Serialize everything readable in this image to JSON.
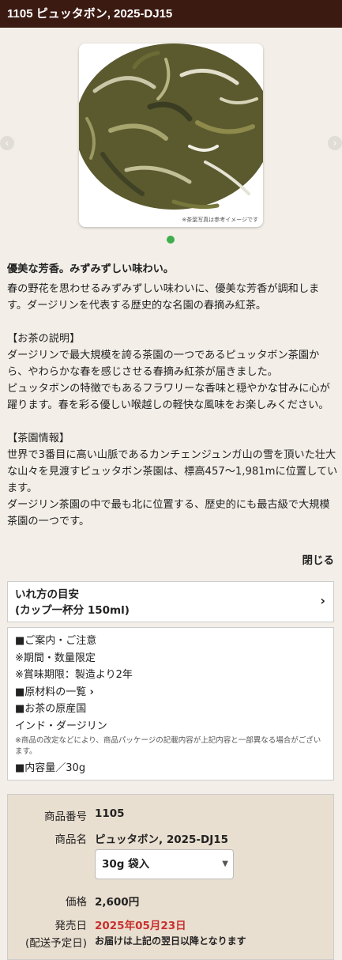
{
  "header": {
    "title": "1105 ピュッタボン, 2025-DJ15"
  },
  "gallery": {
    "caption": "※茶葉写真は参考イメージです",
    "prev_icon": "chevron-left-icon",
    "next_icon": "chevron-right-icon",
    "prev_glyph": "‹",
    "next_glyph": "›",
    "dot_color": "#3fae4c"
  },
  "description": {
    "catch": "優美な芳香。みずみずしい味わい。",
    "p1": "春の野花を思わせるみずみずしい味わいに、優美な芳香が調和します。ダージリンを代表する歴史的な名園の春摘み紅茶。",
    "p2_title": "【お茶の説明】",
    "p2": "ダージリンで最大規模を誇る茶園の一つであるピュッタボン茶園から、やわらかな春を感じさせる春摘み紅茶が届きました。\nピュッタボンの特徴でもあるフラワリーな香味と穏やかな甘みに心が躍ります。春を彩る優しい喉越しの軽快な風味をお楽しみください。",
    "p3_title": "【茶園情報】",
    "p3": "世界で3番目に高い山脈であるカンチェンジュンガ山の雪を頂いた壮大な山々を見渡すピュッタボン茶園は、標高457～1,981mに位置しています。\nダージリン茶園の中で最も北に位置する、歴史的にも最古級で大規模茶園の一つです。",
    "close": "閉じる"
  },
  "brew_guide": {
    "line1": "いれ方の目安",
    "line2": "(カップ一杯分 150ml)",
    "chevron": "›"
  },
  "notes": {
    "l1": "■ご案内・ご注意",
    "l2": "※期間・数量限定",
    "l3": "※賞味期限：製造より2年",
    "l4": "■原材料の一覧",
    "l4_chev": "›",
    "l5": "■お茶の原産国",
    "l6": "インド・ダージリン",
    "small": "※商品の改定などにより、商品パッケージの記載内容が上記内容と一部異なる場合がございます。",
    "l7": "■内容量／30g"
  },
  "product": {
    "number_label": "商品番号",
    "number": "1105",
    "name_label": "商品名",
    "name": "ピュッタボン, 2025-DJ15",
    "select_value": "30g 袋入",
    "price_label": "価格",
    "price": "2,600円",
    "release_label": "発売日",
    "release": "2025年05月23日",
    "ship_label": "(配送予定日)",
    "ship": "お届けは上記の翌日以降となります"
  }
}
